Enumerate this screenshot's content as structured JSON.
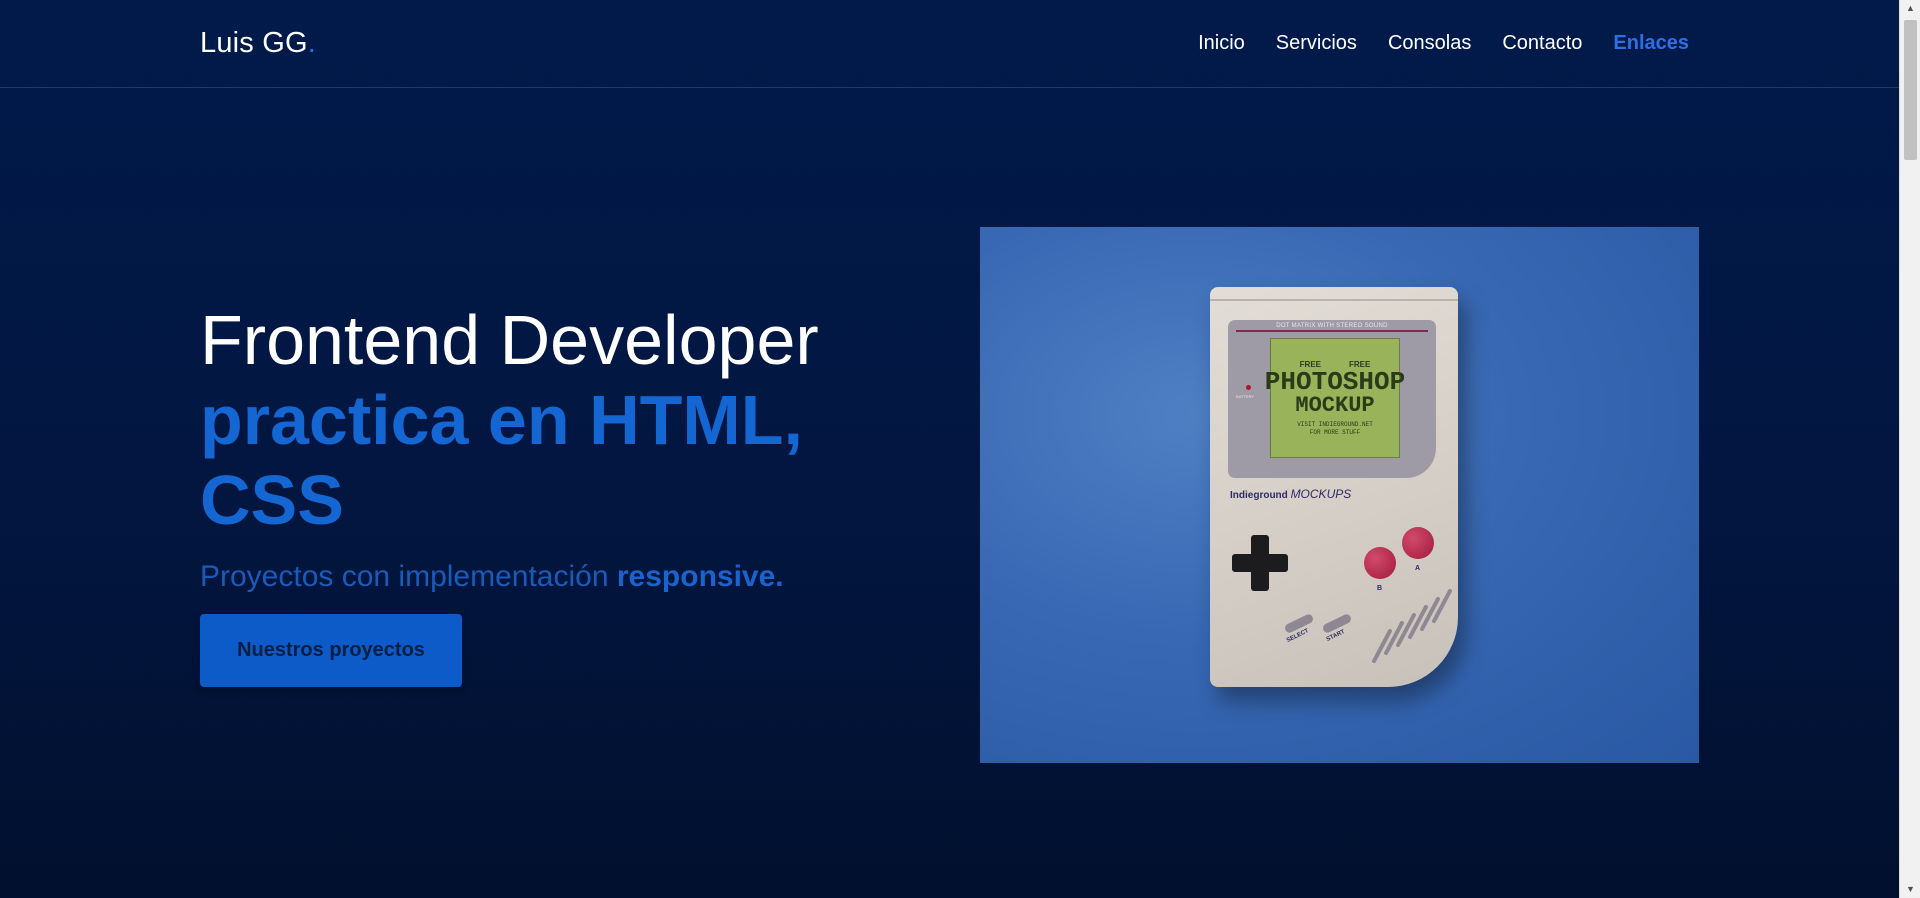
{
  "header": {
    "logo_text": "Luis GG",
    "logo_dot": ".",
    "nav": [
      {
        "label": "Inicio"
      },
      {
        "label": "Servicios"
      },
      {
        "label": "Consolas"
      },
      {
        "label": "Contacto"
      },
      {
        "label": "Enlaces"
      }
    ],
    "active_nav": "Enlaces"
  },
  "hero": {
    "title_line1": "Frontend Developer",
    "title_line2": "practica en HTML,",
    "title_line3": "CSS",
    "subtitle_pre": "Proyectos con implementación ",
    "subtitle_bold": "responsive.",
    "cta_label": "Nuestros proyectos"
  },
  "hero_image": {
    "bezel_title": "DOT MATRIX WITH STEREO SOUND",
    "battery_label": "BATTERY",
    "screen_free_left": "FREE",
    "screen_free_right": "FREE",
    "screen_line1": "PHOTOSHOP",
    "screen_line2": "MOCKUP",
    "screen_small1": "VISIT INDIEGROUND.NET",
    "screen_small2": "FOR MORE STUFF",
    "brand": "Indieground",
    "brand_italic": "MOCKUPS",
    "btn_b": "B",
    "btn_a": "A",
    "select_label": "SELECT",
    "start_label": "START"
  },
  "colors": {
    "background": "#011a4a",
    "accent": "#2f6fe4",
    "heading_blue": "#1466d2",
    "button": "#0c5bc8"
  }
}
